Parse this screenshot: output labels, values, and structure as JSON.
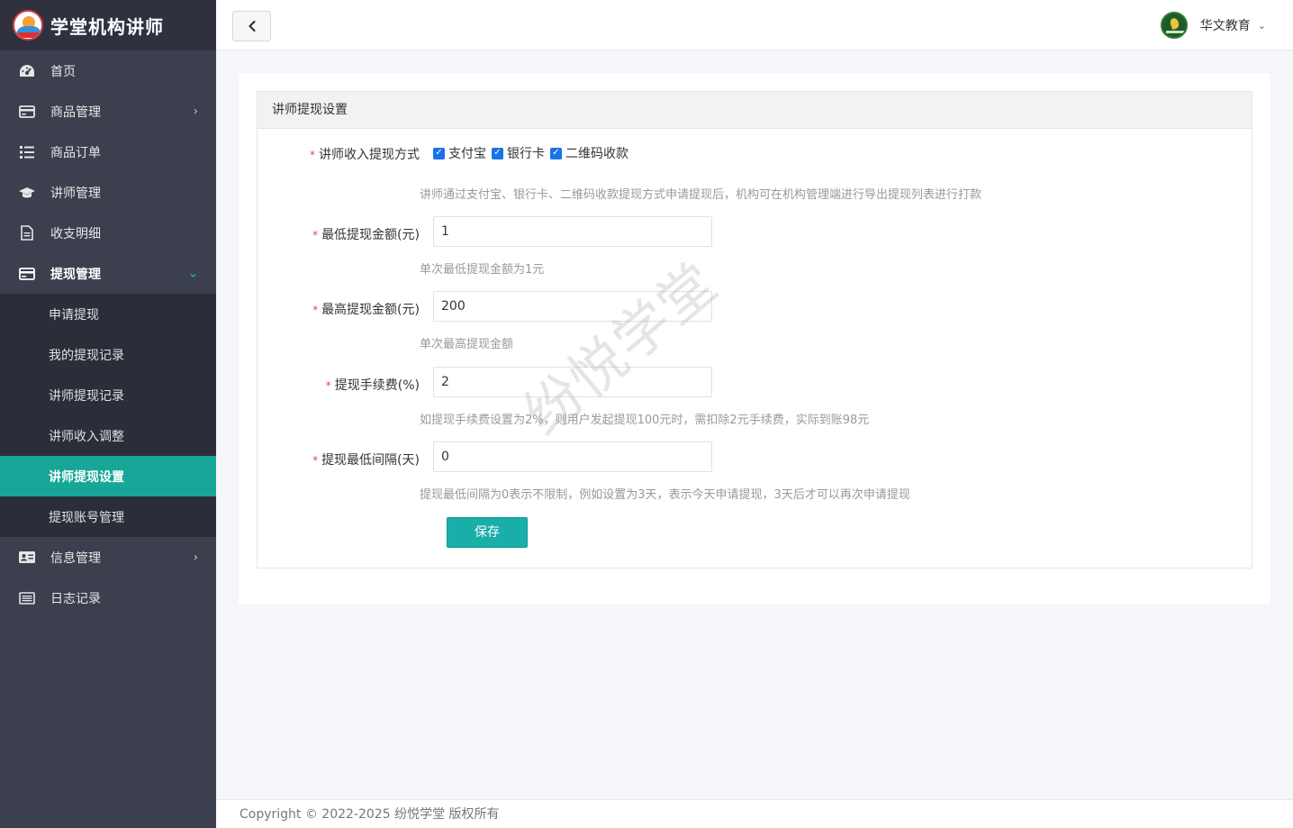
{
  "app": {
    "title": "学堂机构讲师"
  },
  "sidebar": {
    "items": [
      {
        "label": "首页",
        "icon": "dashboard-icon"
      },
      {
        "label": "商品管理",
        "icon": "card-icon"
      },
      {
        "label": "商品订单",
        "icon": "list-icon"
      },
      {
        "label": "讲师管理",
        "icon": "graduation-cap-icon"
      },
      {
        "label": "收支明细",
        "icon": "document-icon"
      },
      {
        "label": "提现管理",
        "icon": "card-icon"
      },
      {
        "label": "信息管理",
        "icon": "id-card-icon"
      },
      {
        "label": "日志记录",
        "icon": "log-icon"
      }
    ],
    "withdraw_submenu": [
      {
        "label": "申请提现"
      },
      {
        "label": "我的提现记录"
      },
      {
        "label": "讲师提现记录"
      },
      {
        "label": "讲师收入调整"
      },
      {
        "label": "讲师提现设置"
      },
      {
        "label": "提现账号管理"
      }
    ],
    "accent_color": "#17a697"
  },
  "topbar": {
    "user_name": "华文教育"
  },
  "panel": {
    "title": "讲师提现设置"
  },
  "form": {
    "method_label": "讲师收入提现方式",
    "methods": [
      {
        "label": "支付宝",
        "checked": true
      },
      {
        "label": "银行卡",
        "checked": true
      },
      {
        "label": "二维码收款",
        "checked": true
      }
    ],
    "method_hint": "讲师通过支付宝、银行卡、二维码收款提现方式申请提现后，机构可在机构管理端进行导出提现列表进行打款",
    "min_label": "最低提现金额(元)",
    "min_value": "1",
    "min_hint": "单次最低提现金额为1元",
    "max_label": "最高提现金额(元)",
    "max_value": "200",
    "max_hint": "单次最高提现金额",
    "fee_label": "提现手续费(%)",
    "fee_value": "2",
    "fee_hint": "如提现手续费设置为2%，则用户发起提现100元时，需扣除2元手续费，实际到账98元",
    "interval_label": "提现最低间隔(天)",
    "interval_value": "0",
    "interval_hint": "提现最低间隔为0表示不限制，例如设置为3天，表示今天申请提现，3天后才可以再次申请提现",
    "save_label": "保存"
  },
  "watermark": "纷悦学堂",
  "footer": {
    "text": "Copyright © 2022-2025 纷悦学堂 版权所有"
  }
}
